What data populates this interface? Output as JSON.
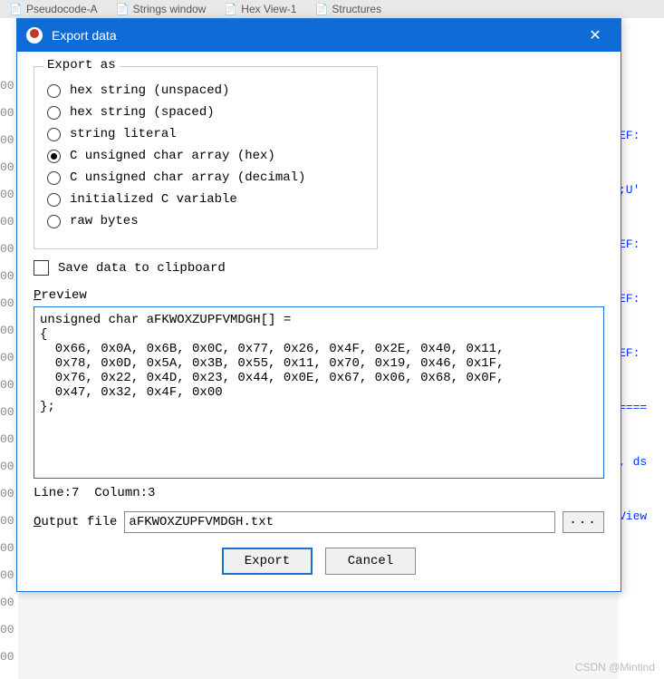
{
  "background": {
    "tabs": [
      "Pseudocode-A",
      "Strings window",
      "Hex View-1",
      "Structures"
    ],
    "left_column_text": "00",
    "right_fragments": [
      "EF:",
      ";U'",
      "EF:",
      "EF:",
      "EF:",
      "====",
      ", ds",
      "View"
    ]
  },
  "dialog": {
    "title": "Export data",
    "group_legend": "Export as",
    "options": [
      {
        "label": "hex string (unspaced)",
        "selected": false
      },
      {
        "label": "hex string (spaced)",
        "selected": false
      },
      {
        "label": "string literal",
        "selected": false
      },
      {
        "label": "C unsigned char array (hex)",
        "selected": true
      },
      {
        "label": "C unsigned char array (decimal)",
        "selected": false
      },
      {
        "label": "initialized C variable",
        "selected": false
      },
      {
        "label": "raw bytes",
        "selected": false
      }
    ],
    "checkbox_label": "Save data to clipboard",
    "checkbox_checked": false,
    "preview_label_underline": "P",
    "preview_label_rest": "review",
    "preview_text": "unsigned char aFKWOXZUPFVMDGH[] =\n{\n  0x66, 0x0A, 0x6B, 0x0C, 0x77, 0x26, 0x4F, 0x2E, 0x40, 0x11, \n  0x78, 0x0D, 0x5A, 0x3B, 0x55, 0x11, 0x70, 0x19, 0x46, 0x1F, \n  0x76, 0x22, 0x4D, 0x23, 0x44, 0x0E, 0x67, 0x06, 0x68, 0x0F, \n  0x47, 0x32, 0x4F, 0x00\n};",
    "status": {
      "line": 7,
      "column": 3
    },
    "output_label_underline": "O",
    "output_label_rest": "utput file",
    "output_file": "aFKWOXZUPFVMDGH.txt",
    "browse_label": "...",
    "export_label": "Export",
    "cancel_label": "Cancel"
  },
  "watermark": "CSDN @Mintind"
}
